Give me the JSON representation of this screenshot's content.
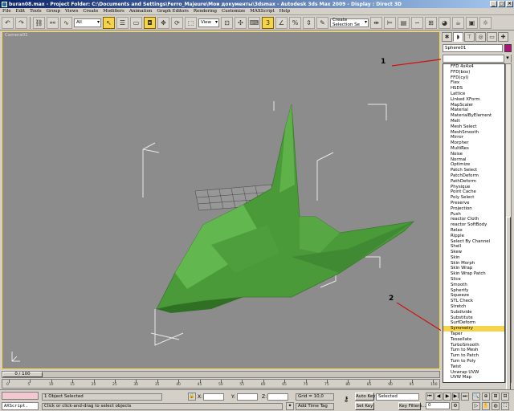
{
  "title_bar": {
    "text": "buran08.max    - Project Folder: C:\\Documents and Settings\\Ferro_Majeure\\Мои документы\\3dsmax    - Autodesk 3ds Max  2009       - Display : Direct 3D",
    "controls": [
      "_",
      "□",
      "×"
    ]
  },
  "menu": [
    "File",
    "Edit",
    "Tools",
    "Group",
    "Views",
    "Create",
    "Modifiers",
    "Animation",
    "Graph Editors",
    "Rendering",
    "Customize",
    "MAXScript",
    "Help"
  ],
  "toolbar": {
    "selection_filter": "All",
    "reference_coord": "View",
    "named_selection_placeholder": "Create Selection Se"
  },
  "viewport": {
    "label": "Camera01",
    "border_color": "#f5d34a",
    "model_color": "#4a9a3a"
  },
  "command_panel": {
    "tabs": [
      "create-tab",
      "modify-tab",
      "hierarchy-tab",
      "motion-tab",
      "display-tab",
      "utilities-tab"
    ],
    "object_name": "Sphere01",
    "object_color": "#b0107a",
    "modifier_dropdown_value": "",
    "modifiers": [
      "FFD 4x4x4",
      "FFD(box)",
      "FFD(cyl)",
      "Flex",
      "HSDS",
      "Lattice",
      "Linked XForm",
      "MapScaler",
      "Material",
      "MaterialByElement",
      "Melt",
      "Mesh Select",
      "MeshSmooth",
      "Mirror",
      "Morpher",
      "MultiRes",
      "Noise",
      "Normal",
      "Optimize",
      "Patch Select",
      "PatchDeform",
      "PathDeform",
      "Physique",
      "Point Cache",
      "Poly Select",
      "Preserve",
      "Projection",
      "Push",
      "reactor Cloth",
      "reactor SoftBody",
      "Relax",
      "Ripple",
      "Select By Channel",
      "Shell",
      "Skew",
      "Skin",
      "Skin Morph",
      "Skin Wrap",
      "Skin Wrap Patch",
      "Slice",
      "Smooth",
      "Spherify",
      "Squeeze",
      "STL Check",
      "Stretch",
      "Subdivide",
      "Substitute",
      "SurfDeform",
      "Symmetry",
      "Taper",
      "Tessellate",
      "TurboSmooth",
      "Turn to Mesh",
      "Turn to Patch",
      "Turn to Poly",
      "Twist",
      "Unwrap UVW",
      "UVW Map"
    ],
    "selected_modifier": "Symmetry"
  },
  "annotations": {
    "marker_1": "1",
    "marker_2": "2"
  },
  "timeline": {
    "frame_display": "0 / 100",
    "ticks": [
      "0",
      "5",
      "10",
      "15",
      "20",
      "25",
      "30",
      "35",
      "40",
      "45",
      "50",
      "55",
      "60",
      "65",
      "70",
      "75",
      "80",
      "85",
      "90",
      "95",
      "100"
    ]
  },
  "status": {
    "maxscript_label": "AXScript.",
    "selection_count": "1 Object Selected",
    "prompt": "Click or click-and-drag to select objects",
    "x_label": "X:",
    "y_label": "Y:",
    "z_label": "Z:",
    "grid": "Grid = 10,0",
    "add_time_tag": "Add Time Tag",
    "auto_key": "Auto Key",
    "set_key": "Set Key",
    "key_mode_value": "Selected",
    "key_filters": "Key Filters...",
    "frame_value": "0"
  }
}
